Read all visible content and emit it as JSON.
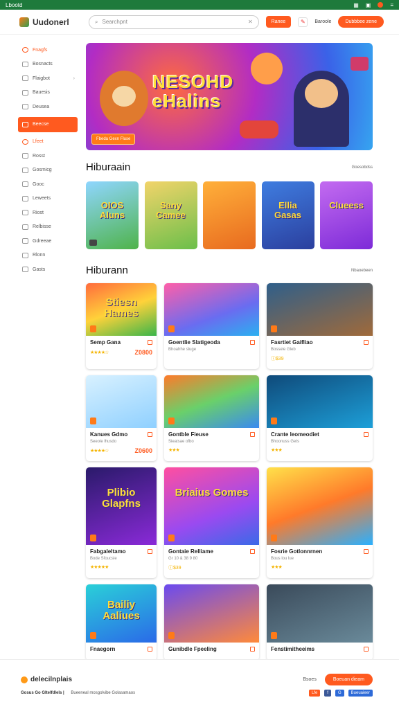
{
  "topbar": {
    "brand": "Lbootd"
  },
  "header": {
    "logo_text": "Uudonerl",
    "search_placeholder": "Searchpnt",
    "btn1": "Ranee",
    "user_text": "Baroole",
    "btn2": "Dubbbee zene"
  },
  "sidebar": {
    "items": [
      {
        "label": "Fnagfs",
        "hot": true
      },
      {
        "label": "Bosnacts"
      },
      {
        "label": "Flaigbot",
        "chevron": true
      },
      {
        "label": "Bauesis"
      },
      {
        "label": "Deusea"
      },
      {
        "label": "Beecse",
        "active": true
      },
      {
        "label": "Lfeet",
        "hot": true
      },
      {
        "label": "Rosst"
      },
      {
        "label": "Gosmicg"
      },
      {
        "label": "Gooc"
      },
      {
        "label": "Leweets"
      },
      {
        "label": "Riost"
      },
      {
        "label": "Relbisse"
      },
      {
        "label": "Gdreeae"
      },
      {
        "label": "Rlonn"
      },
      {
        "label": "Gasts"
      }
    ]
  },
  "hero": {
    "title_line1": "NESOHD",
    "title_line2": "eHalins",
    "button": "Fbeda Gexn Fluse"
  },
  "section1": {
    "title": "Hiburaain",
    "link": "Goesobdss",
    "thumbs": [
      {
        "title": "OIOS Aluns"
      },
      {
        "title": "Sany Camee"
      },
      {
        "title": ""
      },
      {
        "title": "Ellia Gasas"
      },
      {
        "title": "Clueess"
      }
    ]
  },
  "section2": {
    "title": "Hiburann",
    "link": "Nbaoebeen",
    "cards": [
      {
        "name": "Semp Gana",
        "sub": "",
        "rating": "★★★★☆",
        "price": "Z0800",
        "art": "Stiesn Hames"
      },
      {
        "name": "Goentlie Slatigeoda",
        "sub": "Bhoahhe sluge",
        "rating": "",
        "price": "",
        "art": ""
      },
      {
        "name": "Fasrtiet Gaifliao",
        "sub": "Bossele Gleb",
        "rating": "ⓘ $ 3 9",
        "price": "",
        "art": ""
      },
      {
        "name": "Kanues Gdmo",
        "sub": "Seeole lhusdo",
        "rating": "★★★★☆",
        "price": "Z0600",
        "art": ""
      },
      {
        "name": "Gontble Fieuse",
        "sub": "Sieatsae ofbo",
        "rating": "★★★",
        "price": "",
        "art": ""
      },
      {
        "name": "Crante leomeodiet",
        "sub": "Bhoonuss Gets",
        "rating": "★★★",
        "price": "",
        "art": ""
      },
      {
        "name": "Fabgaleltamo",
        "sub": "Bode Sfoucsle",
        "rating": "★★★★★",
        "price": "",
        "art": "Plibio Glapfns"
      },
      {
        "name": "Gontaie Relliame",
        "sub": "Gr 10 & 38 9 80",
        "rating": "ⓘ $ 3 9",
        "price": "",
        "art": "Briaius Gomes"
      },
      {
        "name": "Fosrie Gotlonnrnen",
        "sub": "Bous lou lue",
        "rating": "★★★",
        "price": "",
        "art": ""
      },
      {
        "name": "Fnaegorn",
        "sub": "",
        "rating": "",
        "price": "",
        "art": "Bailiy Aaliues"
      },
      {
        "name": "Gunibdle Fpeeling",
        "sub": "",
        "rating": "",
        "price": "",
        "art": ""
      },
      {
        "name": "Fenstimitheeims",
        "sub": "",
        "rating": "",
        "price": "",
        "art": ""
      }
    ]
  },
  "footer": {
    "logo_text": "delecilnplais",
    "text1": "Gosus Go Gltelfdlels |",
    "text2": "Bueeneal mosgolvibe Golasamaos",
    "right_text": "Bsoes",
    "button": "Boeuan dieam",
    "social": [
      {
        "label": "Lfe",
        "color": "#ff5a1f"
      },
      {
        "label": "f",
        "color": "#3b5998"
      },
      {
        "label": "G",
        "color": "#2d6ad8"
      },
      {
        "label": "Bueuaieer",
        "color": "#2d6ad8"
      }
    ]
  },
  "colors": {
    "accent": "#ff5a1f",
    "topbar": "#1e7a3c",
    "star": "#f4b400"
  }
}
